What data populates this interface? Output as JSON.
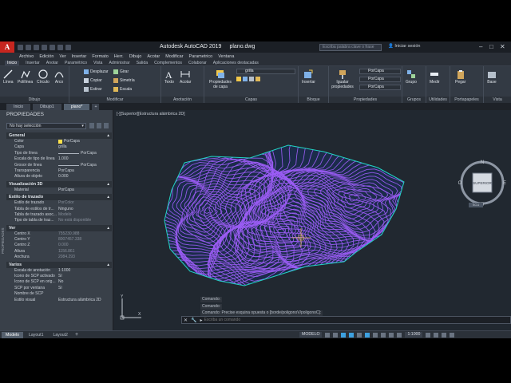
{
  "app": {
    "title": "Autodesk AutoCAD 2019",
    "document": "plano.dwg",
    "logo_letter": "A",
    "search_placeholder": "Escriba palabra clave o frase",
    "signin_label": "Iniciar sesión"
  },
  "menubar": [
    "Archivo",
    "Edición",
    "Ver",
    "Insertar",
    "Formato",
    "Herr.",
    "Dibujo",
    "Acotar",
    "Modificar",
    "Parametrico",
    "Ventana"
  ],
  "ribbon_tabs": [
    "Inicio",
    "Insertar",
    "Anotar",
    "Paramétrico",
    "Vista",
    "Administrar",
    "Salida",
    "Complementos",
    "Colaborar",
    "Aplicaciones destacadas"
  ],
  "ribbon": {
    "draw": {
      "title": "Dibujo",
      "line": "Línea",
      "polyline": "Polilínea",
      "circle": "Círculo",
      "arc": "Arco"
    },
    "modify": {
      "title": "Modificar",
      "move": "Desplazar",
      "rotate": "Girar",
      "copy": "Copiar",
      "mirror": "Simetría",
      "stretch": "Estirar",
      "scale": "Escala"
    },
    "annotation": {
      "title": "Anotación",
      "text": "Texto",
      "dimension": "Acotar"
    },
    "layers": {
      "title": "Capas",
      "properties": "Propiedades de capa",
      "current_layer": "grilla"
    },
    "block": {
      "title": "Bloque",
      "insert": "Insertar"
    },
    "properties": {
      "title": "Propiedades",
      "match": "Igualar propiedades",
      "color": "PorCapa",
      "linetype": "PorCapa",
      "lineweight": "PorCapa"
    },
    "groups": {
      "title": "Grupos",
      "group": "Grupo"
    },
    "utilities": {
      "title": "Utilidades",
      "measure": "Medir"
    },
    "clipboard": {
      "title": "Portapapeles",
      "paste": "Pegar"
    },
    "view": {
      "title": "Vista",
      "base": "Base"
    }
  },
  "doc_tabs": [
    "Inicio",
    "Dibujo1",
    "plano*"
  ],
  "properties_palette": {
    "title": "PROPIEDADES",
    "selection": "No hay selección",
    "side_label": "PROPIEDADES",
    "sections": [
      {
        "name": "General",
        "rows": [
          {
            "k": "Color",
            "v": "PorCapa",
            "type": "swatch"
          },
          {
            "k": "Capa",
            "v": "grilla"
          },
          {
            "k": "Tipo de línea",
            "v": "PorCapa",
            "type": "line"
          },
          {
            "k": "Escala de tipo de línea",
            "v": "1.000"
          },
          {
            "k": "Grosor de línea",
            "v": "PorCapa",
            "type": "line"
          },
          {
            "k": "Transparencia",
            "v": "PorCapa"
          },
          {
            "k": "Altura de objeto",
            "v": "0.000"
          }
        ]
      },
      {
        "name": "Visualización 3D",
        "rows": [
          {
            "k": "Material",
            "v": "PorCapa"
          }
        ]
      },
      {
        "name": "Estilo de trazado",
        "rows": [
          {
            "k": "Estilo de trazado",
            "v": "PorColor",
            "dim": true
          },
          {
            "k": "Tabla de estilos de tr...",
            "v": "Ninguno"
          },
          {
            "k": "Tabla de trazado asoc...",
            "v": "Modelo",
            "dim": true
          },
          {
            "k": "Tipo de tabla de traz...",
            "v": "No está disponible",
            "dim": true
          }
        ]
      },
      {
        "name": "Ver",
        "rows": [
          {
            "k": "Centro X",
            "v": "755230.988",
            "dim": true
          },
          {
            "k": "Centro Y",
            "v": "8007457.338",
            "dim": true
          },
          {
            "k": "Centro Z",
            "v": "0.000",
            "dim": true
          },
          {
            "k": "Altura",
            "v": "1156.861",
            "dim": true
          },
          {
            "k": "Anchura",
            "v": "2084.293",
            "dim": true
          }
        ]
      },
      {
        "name": "Varios",
        "rows": [
          {
            "k": "Escala de anotación",
            "v": "1:1000"
          },
          {
            "k": "Icono de SCP activado",
            "v": "Sí"
          },
          {
            "k": "Icono de SCP en orig...",
            "v": "No"
          },
          {
            "k": "SCP por ventana",
            "v": "Sí"
          },
          {
            "k": "Nombre de SCP",
            "v": ""
          },
          {
            "k": "Estilo visual",
            "v": "Estructura alámbrica 2D"
          }
        ]
      }
    ]
  },
  "viewport": {
    "label": "[-][Superior][Estructura alámbrica 2D]",
    "contour_color": "#9b5cf5",
    "boundary_color": "#22d3c5",
    "fill_color": "#1b2c4a",
    "viewcube": {
      "face": "SUPERIOR",
      "n": "N",
      "s": "S",
      "e": "E",
      "o": "O",
      "nav": "SCU"
    },
    "ucs": {
      "x": "X",
      "y": "Y"
    }
  },
  "command": {
    "history": [
      "Comando:",
      "Comando:",
      "Comando: Precise esquina opuesta o [borde/poligonoV/poligonoC]:"
    ],
    "placeholder": "Escriba un comando"
  },
  "statusbar": {
    "layouts": [
      "Modelo",
      "Layout1",
      "Layout2"
    ],
    "mode": "MODELO",
    "scale": "1:1000"
  }
}
